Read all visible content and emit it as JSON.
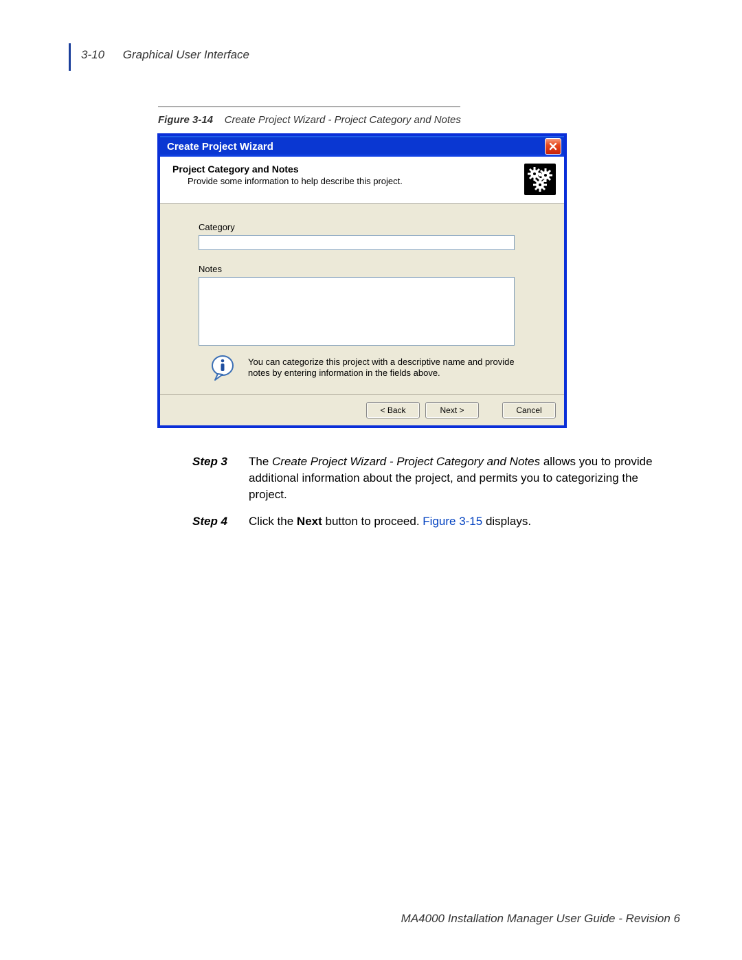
{
  "header": {
    "page_number": "3-10",
    "section_title": "Graphical User Interface"
  },
  "figure": {
    "label": "Figure 3-14",
    "title": "Create Project Wizard - Project Category and Notes"
  },
  "dialog": {
    "title": "Create Project Wizard",
    "banner_title": "Project Category and Notes",
    "banner_subtitle": "Provide some information to help describe this project.",
    "category_label": "Category",
    "category_value": "",
    "notes_label": "Notes",
    "notes_value": "",
    "hint_text": "You can categorize this project with a descriptive name and provide notes by entering information in the fields above.",
    "back_button": "< Back",
    "next_button": "Next >",
    "cancel_button": "Cancel"
  },
  "steps": {
    "step3_label": "Step 3",
    "step3_pre": "The ",
    "step3_ital": "Create Project Wizard - Project Category and Notes",
    "step3_post": " allows you to provide additional information about the project, and permits you to categorizing the project.",
    "step4_label": "Step 4",
    "step4_pre": "Click the ",
    "step4_bold": "Next",
    "step4_mid": " button to proceed. ",
    "step4_link": "Figure 3-15",
    "step4_post": " displays."
  },
  "footer": "MA4000 Installation Manager User Guide - Revision 6"
}
